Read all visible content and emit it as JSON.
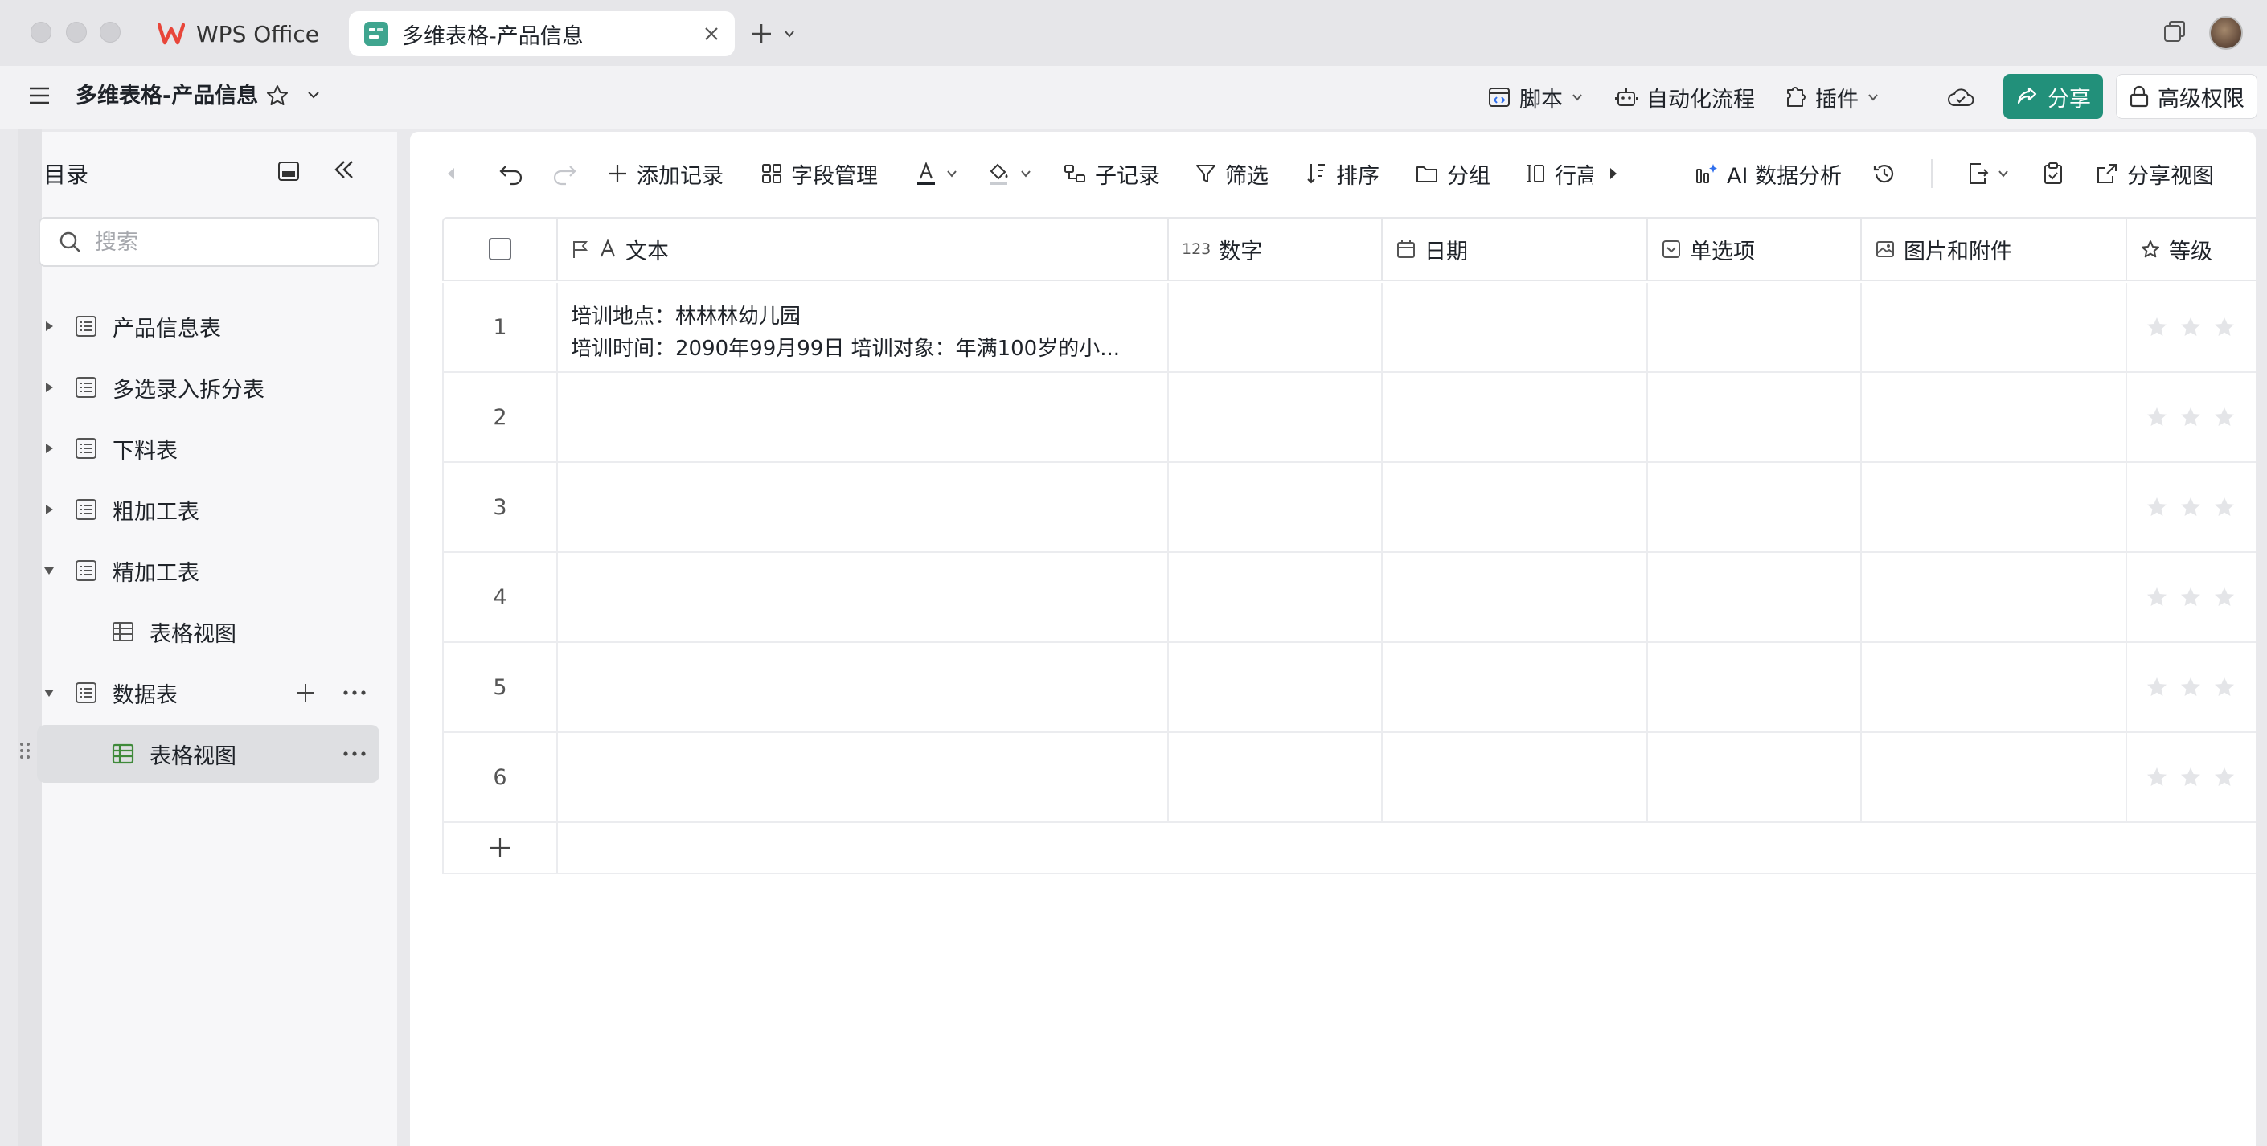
{
  "window": {
    "tabs": [
      {
        "label": "WPS Office"
      },
      {
        "label": "多维表格-产品信息"
      }
    ]
  },
  "header": {
    "doc_title": "多维表格-产品信息",
    "script_label": "脚本",
    "automation_label": "自动化流程",
    "plugin_label": "插件",
    "share_label": "分享",
    "permission_label": "高级权限"
  },
  "sidebar": {
    "title": "目录",
    "search_placeholder": "搜索",
    "items": [
      {
        "label": "产品信息表",
        "expanded": false
      },
      {
        "label": "多选录入拆分表",
        "expanded": false
      },
      {
        "label": "下料表",
        "expanded": false
      },
      {
        "label": "粗加工表",
        "expanded": false
      },
      {
        "label": "精加工表",
        "expanded": true
      },
      {
        "label": "表格视图",
        "child": true
      },
      {
        "label": "数据表",
        "expanded": true
      },
      {
        "label": "表格视图",
        "child": true,
        "selected": true
      }
    ]
  },
  "toolbar": {
    "add_record": "添加记录",
    "field_manage": "字段管理",
    "sub_record": "子记录",
    "filter": "筛选",
    "sort": "排序",
    "group": "分组",
    "row_height": "行高",
    "ai_analysis": "AI 数据分析",
    "share_view": "分享视图"
  },
  "grid": {
    "columns": [
      {
        "label": "文本",
        "icon": "text-icon"
      },
      {
        "label": "数字",
        "icon": "number-icon",
        "icon_text": "123"
      },
      {
        "label": "日期",
        "icon": "calendar-icon"
      },
      {
        "label": "单选项",
        "icon": "single-select-icon"
      },
      {
        "label": "图片和附件",
        "icon": "image-icon"
      },
      {
        "label": "等级",
        "icon": "star-icon"
      }
    ],
    "rows": [
      {
        "num": "1",
        "text_line1": "培训地点：林林林幼儿园",
        "text_line2": "培训时间：2090年99月99日 培训对象：年满100岁的小..."
      },
      {
        "num": "2",
        "text_line1": "",
        "text_line2": ""
      },
      {
        "num": "3",
        "text_line1": "",
        "text_line2": ""
      },
      {
        "num": "4",
        "text_line1": "",
        "text_line2": ""
      },
      {
        "num": "5",
        "text_line1": "",
        "text_line2": ""
      },
      {
        "num": "6",
        "text_line1": "",
        "text_line2": ""
      }
    ]
  },
  "colors": {
    "accent": "#22907a",
    "table_icon_green": "#3f8a3a"
  }
}
